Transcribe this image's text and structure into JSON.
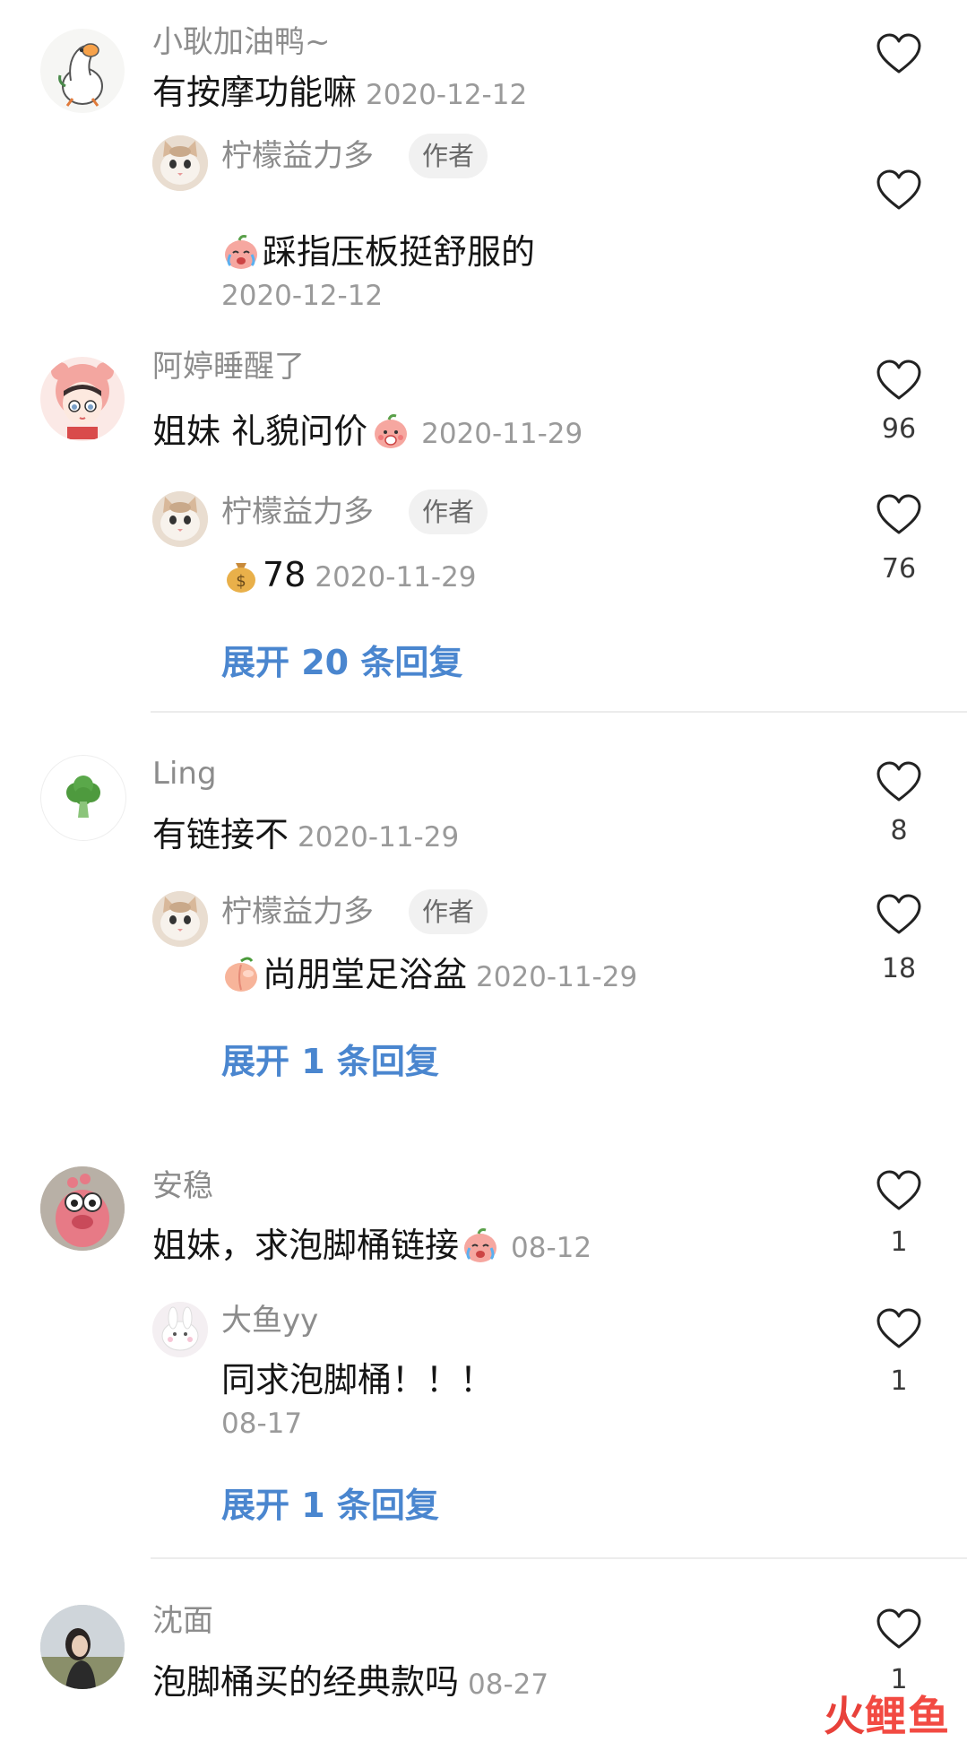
{
  "comments": [
    {
      "author": "小耿加油鸭~",
      "text": "有按摩功能嘛",
      "date": "2020-12-12",
      "avatar": "duck-avatar",
      "likes": "",
      "replies": [
        {
          "author": "柠檬益力多",
          "badge": "作者",
          "emoji": "crying-peach-emoji",
          "text": "踩指压板挺舒服的",
          "date": "2020-12-12",
          "likes": ""
        }
      ],
      "expand": ""
    },
    {
      "author": "阿婷睡醒了",
      "text": "姐妹 礼貌问价",
      "emoji_after": "shy-peach-emoji",
      "date": "2020-11-29",
      "avatar": "girl-bear-hat-avatar",
      "likes": "96",
      "replies": [
        {
          "author": "柠檬益力多",
          "badge": "作者",
          "emoji": "money-bag-emoji",
          "text": "78",
          "date": "2020-11-29",
          "likes": "76"
        }
      ],
      "expand": "展开 20 条回复"
    },
    {
      "author": "Ling",
      "text": "有链接不",
      "date": "2020-11-29",
      "avatar": "broccoli-avatar",
      "likes": "8",
      "replies": [
        {
          "author": "柠檬益力多",
          "badge": "作者",
          "emoji": "peach-emoji",
          "text": "尚朋堂足浴盆",
          "date": "2020-11-29",
          "likes": "18"
        }
      ],
      "expand": "展开 1 条回复"
    },
    {
      "author": "安稳",
      "text": "姐妹，求泡脚桶链接",
      "emoji_after": "crying-peach-emoji",
      "date": "08-12",
      "avatar": "pink-toy-avatar",
      "likes": "1",
      "replies": [
        {
          "author": "大鱼yy",
          "text": "同求泡脚桶！！！",
          "date": "08-17",
          "likes": "1"
        }
      ],
      "expand": "展开 1 条回复"
    },
    {
      "author": "沈面",
      "text": "泡脚桶买的经典款吗",
      "date": "08-27",
      "avatar": "girl-photo-avatar",
      "likes": "1"
    }
  ],
  "watermark": {
    "fire": "火",
    "name": "鲤鱼"
  },
  "colors": {
    "name": "#8c8c8c",
    "text": "#151515",
    "date": "#9a9a9a",
    "expand": "#4a86cf",
    "watermark": "#e8413a"
  }
}
